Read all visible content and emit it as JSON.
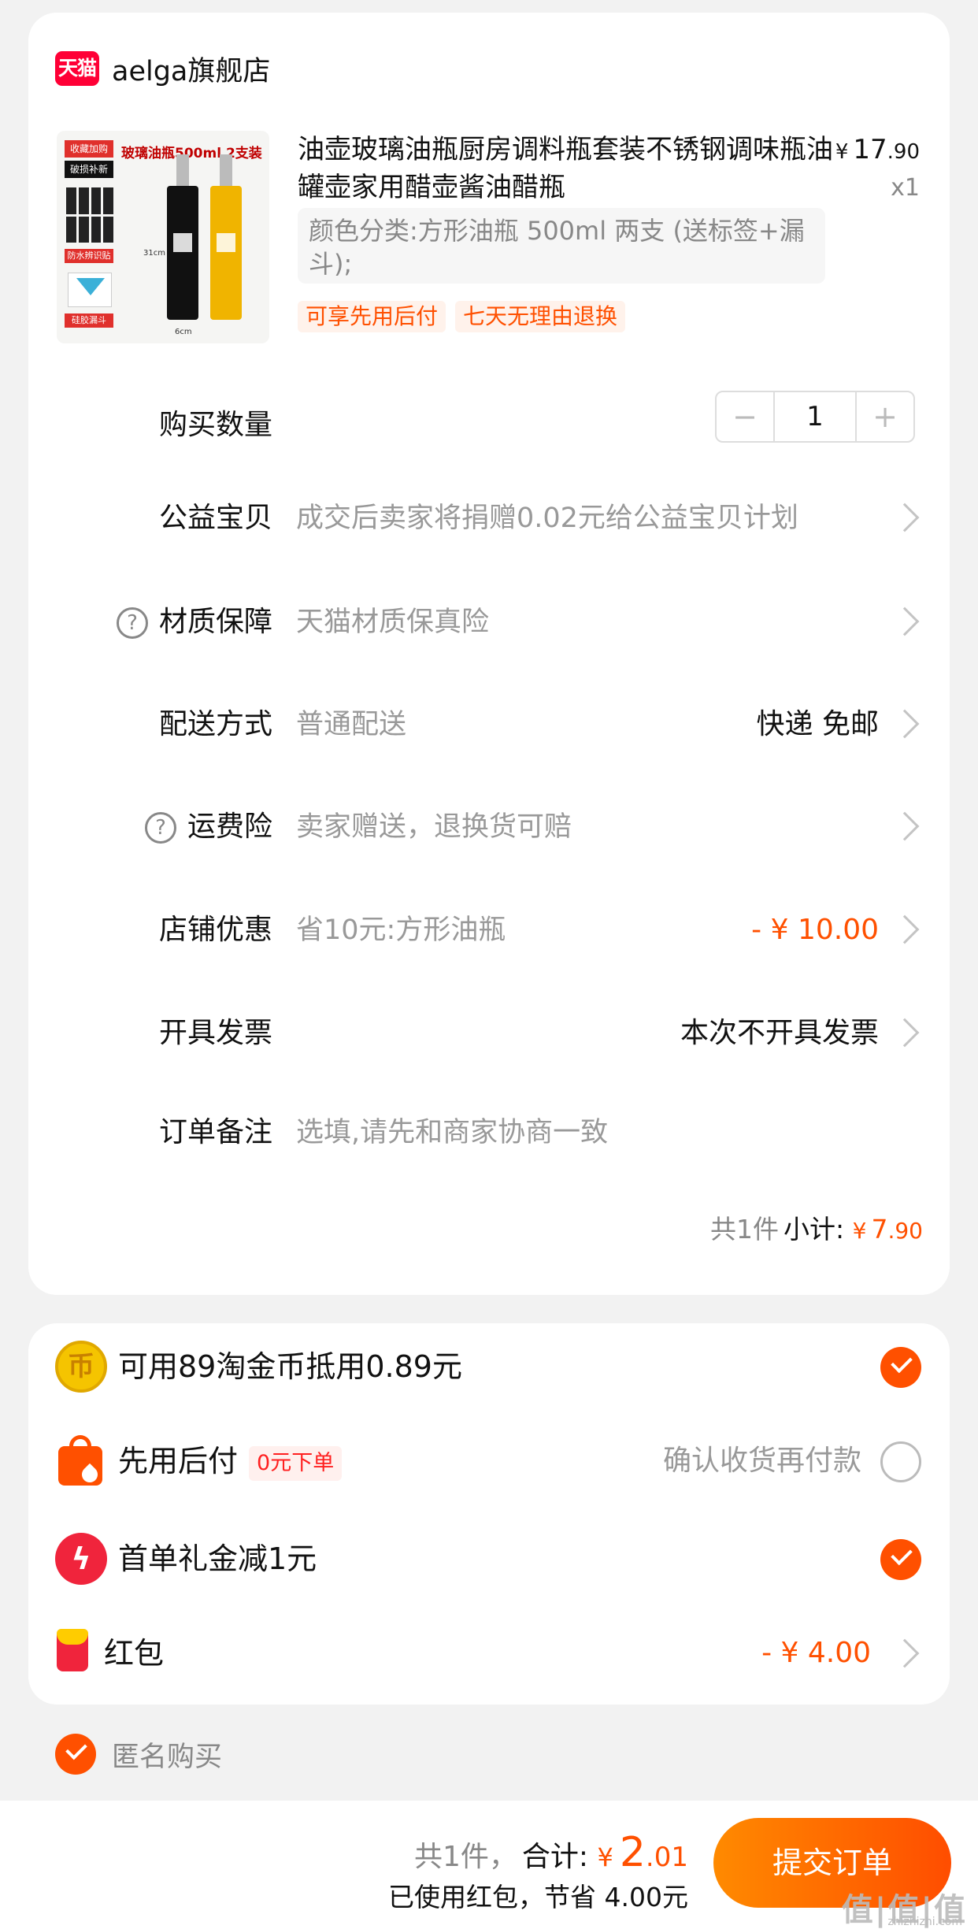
{
  "shop": {
    "logo_text": "天猫",
    "name": "aelga旗舰店"
  },
  "product": {
    "image_title": "玻璃油瓶500ml 2支装",
    "image_tags": [
      "收藏加购",
      "破损补新",
      "防水辨识贴",
      "硅胶漏斗"
    ],
    "image_dims": [
      "31cm",
      "6cm"
    ],
    "title": "油壶玻璃油瓶厨房调料瓶套装不锈钢调味瓶油罐壶家用醋壶酱油醋瓶",
    "price_yen": "¥",
    "price_int": "17",
    "price_dec": ".90",
    "quantity": "x1",
    "sku": "颜色分类:方形油瓶 500ml 两支 (送标签+漏斗);",
    "promo_tags": [
      "可享先用后付",
      "七天无理由退换"
    ]
  },
  "rows": {
    "quantity": {
      "label": "购买数量",
      "value": "1",
      "minus": "−",
      "plus": "+"
    },
    "charity": {
      "label": "公益宝贝",
      "value": "成交后卖家将捐赠0.02元给公益宝贝计划"
    },
    "material": {
      "label": "材质保障",
      "value": "天猫材质保真险"
    },
    "shipping": {
      "label": "配送方式",
      "value": "普通配送",
      "right": "快递 免邮"
    },
    "freight_insurance": {
      "label": "运费险",
      "value": "卖家赠送，退换货可赔"
    },
    "store_discount": {
      "label": "店铺优惠",
      "value": "省10元:方形油瓶",
      "right": "- ¥ 10.00"
    },
    "invoice": {
      "label": "开具发票",
      "right": "本次不开具发票"
    },
    "note": {
      "label": "订单备注",
      "placeholder": "选填,请先和商家协商一致"
    }
  },
  "subtotal": {
    "count": "共1件",
    "label": "小计:",
    "yen": "¥",
    "int": "7",
    "dec": ".90"
  },
  "payments": {
    "coins": {
      "icon_char": "币",
      "text": "可用89淘金币抵用0.89元"
    },
    "pay_later": {
      "text": "先用后付",
      "badge": "0元下单",
      "right": "确认收货再付款"
    },
    "first_order": {
      "icon_char": "ϟ",
      "text": "首单礼金减1元"
    },
    "red_packet": {
      "text": "红包",
      "right": "- ¥ 4.00"
    }
  },
  "anonymous": {
    "label": "匿名购买"
  },
  "bottom": {
    "count": "共1件，",
    "total_label": "合计:",
    "total_yen": "¥",
    "total_int": "2",
    "total_dec": ".01",
    "saved": "已使用红包，节省 4.00元",
    "submit": "提交订单"
  },
  "watermark": {
    "text": "值|值|值",
    "sub": "zhizhizhi.com"
  },
  "colors": {
    "accent": "#ff5000",
    "tmall_red": "#ff0036",
    "background": "#f2f2f2"
  }
}
